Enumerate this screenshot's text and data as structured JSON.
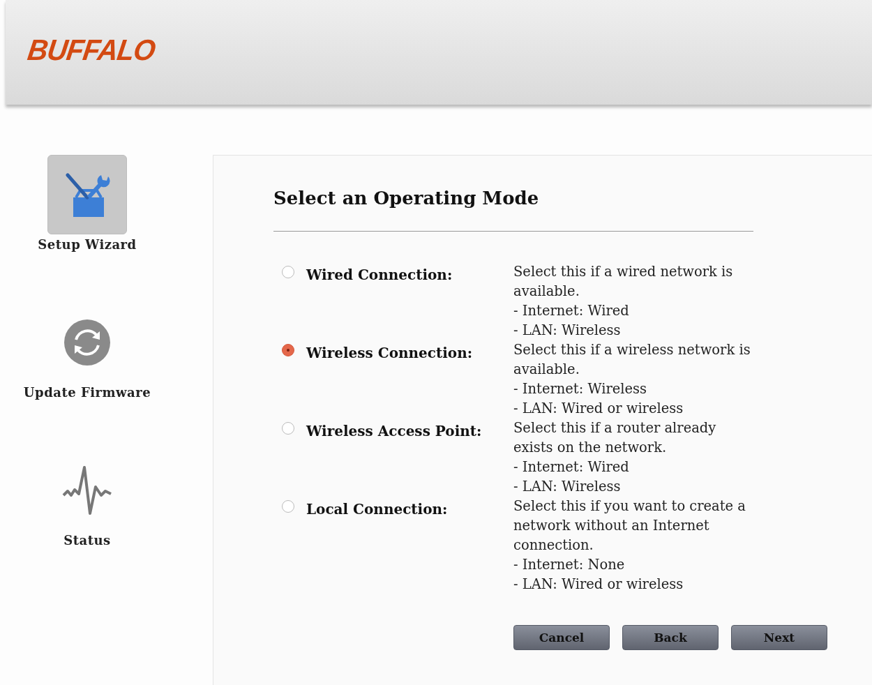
{
  "header": {
    "logo": "BUFFALO"
  },
  "sidebar": {
    "items": [
      {
        "label": "Setup Wizard",
        "kind": "wizard",
        "selected": true
      },
      {
        "label": "Update Firmware",
        "kind": "firmware",
        "selected": false
      },
      {
        "label": "Status",
        "kind": "status",
        "selected": false
      }
    ]
  },
  "panel": {
    "title": "Select an Operating Mode",
    "options": [
      {
        "label": "Wired Connection:",
        "selected": false,
        "description": "Select this if a wired network is available.",
        "details": [
          "- Internet: Wired",
          "- LAN: Wireless"
        ]
      },
      {
        "label": "Wireless Connection:",
        "selected": true,
        "description": "Select this if a wireless network is available.",
        "details": [
          "- Internet: Wireless",
          "- LAN: Wired or wireless"
        ]
      },
      {
        "label": "Wireless Access Point:",
        "selected": false,
        "description": "Select this if a router already exists on the network.",
        "details": [
          "- Internet: Wired",
          "- LAN: Wireless"
        ]
      },
      {
        "label": "Local Connection:",
        "selected": false,
        "description": "Select this if you want to create a network without an Internet connection.",
        "details": [
          "- Internet: None",
          "- LAN: Wired or wireless"
        ]
      }
    ],
    "buttons": [
      "Cancel",
      "Back",
      "Next"
    ]
  }
}
